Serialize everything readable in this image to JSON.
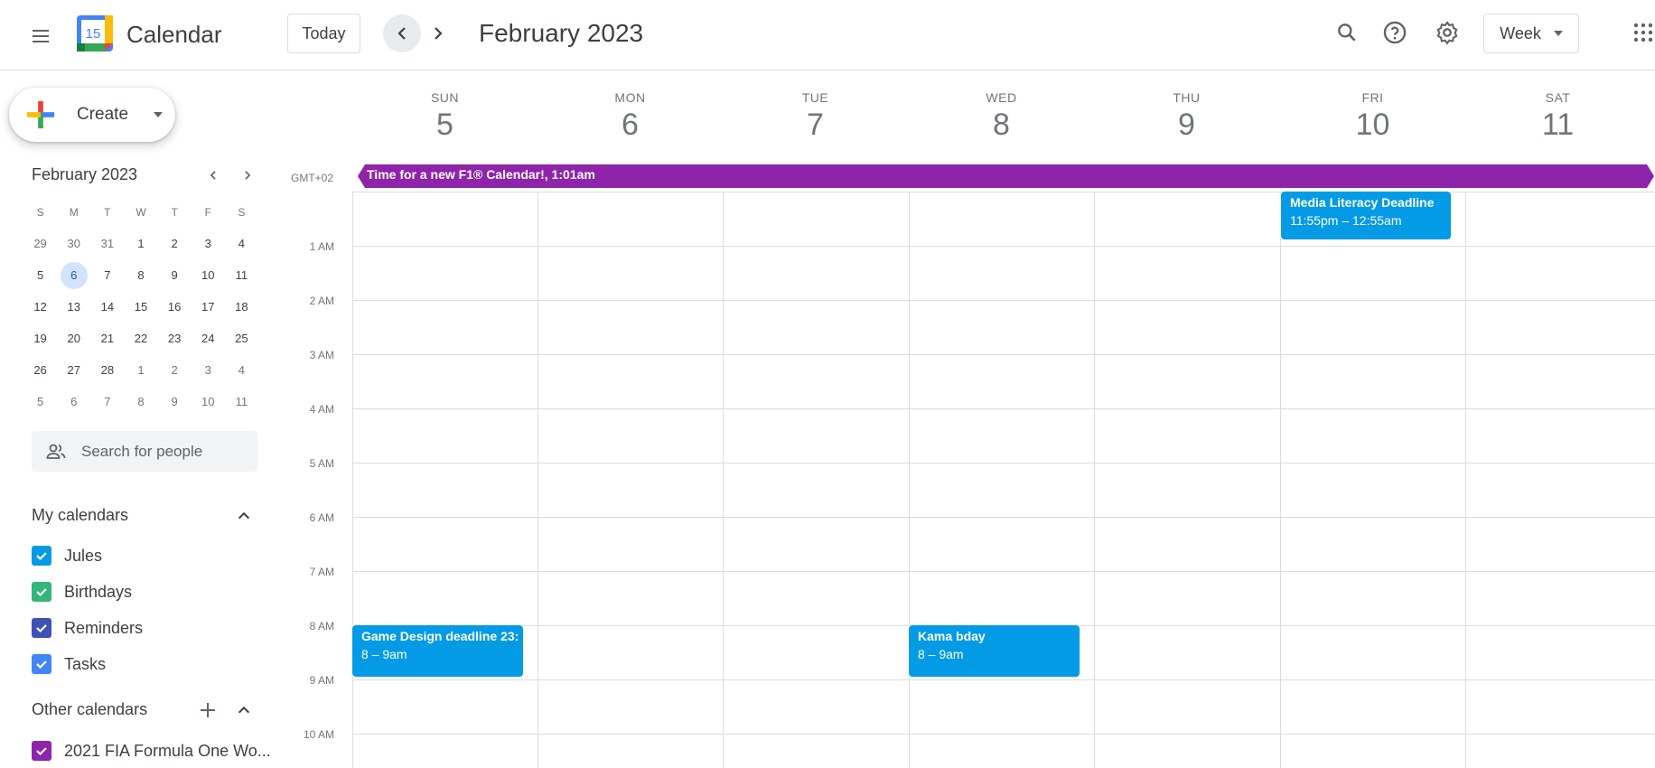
{
  "header": {
    "app_title": "Calendar",
    "logo_day": "15",
    "today_label": "Today",
    "month_title": "February 2023",
    "view_label": "Week"
  },
  "create": {
    "label": "Create"
  },
  "mini_calendar": {
    "title": "February 2023",
    "weekdays": [
      "S",
      "M",
      "T",
      "W",
      "T",
      "F",
      "S"
    ],
    "weeks": [
      [
        "29",
        "30",
        "31",
        "1",
        "2",
        "3",
        "4"
      ],
      [
        "5",
        "6",
        "7",
        "8",
        "9",
        "10",
        "11"
      ],
      [
        "12",
        "13",
        "14",
        "15",
        "16",
        "17",
        "18"
      ],
      [
        "19",
        "20",
        "21",
        "22",
        "23",
        "24",
        "25"
      ],
      [
        "26",
        "27",
        "28",
        "1",
        "2",
        "3",
        "4"
      ],
      [
        "5",
        "6",
        "7",
        "8",
        "9",
        "10",
        "11"
      ]
    ],
    "today": "6"
  },
  "search_people": {
    "placeholder": "Search for people"
  },
  "my_calendars": {
    "title": "My calendars",
    "items": [
      {
        "label": "Jules",
        "color": "#039be5"
      },
      {
        "label": "Birthdays",
        "color": "#33b679"
      },
      {
        "label": "Reminders",
        "color": "#3f51b5"
      },
      {
        "label": "Tasks",
        "color": "#4285f4"
      }
    ]
  },
  "other_calendars": {
    "title": "Other calendars",
    "items": [
      {
        "label": "2021 FIA Formula One Wo...",
        "color": "#8e24aa"
      }
    ]
  },
  "week": {
    "timezone": "GMT+02",
    "days": [
      {
        "dow": "SUN",
        "num": "5"
      },
      {
        "dow": "MON",
        "num": "6"
      },
      {
        "dow": "TUE",
        "num": "7"
      },
      {
        "dow": "WED",
        "num": "8"
      },
      {
        "dow": "THU",
        "num": "9"
      },
      {
        "dow": "FRI",
        "num": "10"
      },
      {
        "dow": "SAT",
        "num": "11"
      }
    ],
    "hours": [
      "1 AM",
      "2 AM",
      "3 AM",
      "4 AM",
      "5 AM",
      "6 AM",
      "7 AM",
      "8 AM",
      "9 AM",
      "10 AM"
    ]
  },
  "allday_event": {
    "text": "Time for a new F1® Calendar!, 1:01am",
    "color": "#8e24aa"
  },
  "events": [
    {
      "title": "Media Literacy Deadline",
      "time": "11:55pm – 12:55am",
      "color": "#039be5"
    },
    {
      "title": "Game Design deadline 23:",
      "time": "8 – 9am",
      "color": "#039be5"
    },
    {
      "title": "Kama bday",
      "time": "8 – 9am",
      "color": "#039be5"
    }
  ],
  "icons": [
    "menu-icon",
    "calendar-logo-icon",
    "chevron-left-icon",
    "chevron-right-icon",
    "search-icon",
    "help-icon",
    "settings-icon",
    "dropdown-caret-icon",
    "apps-grid-icon",
    "plus-icon",
    "people-icon",
    "chevron-up-icon",
    "checkbox-icon"
  ]
}
